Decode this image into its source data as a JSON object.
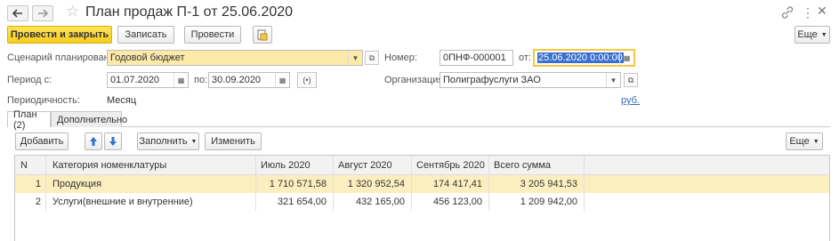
{
  "window": {
    "title": "План продаж П-1 от 25.06.2020"
  },
  "toolbar": {
    "post_close_label": "Провести и закрыть",
    "save_label": "Записать",
    "post_label": "Провести",
    "more_label": "Еще"
  },
  "form": {
    "scenario_label": "Сценарий планирования:",
    "scenario_value": "Годовой бюджет",
    "number_label": "Номер:",
    "number_value": "0ПНФ-000001",
    "date_label": "от:",
    "date_value": "25.06.2020  0:00:00",
    "period_label": "Период с:",
    "period_from": "01.07.2020",
    "period_to_label": "по:",
    "period_to": "30.09.2020",
    "org_label": "Организация:",
    "org_value": "Полиграфуслуги ЗАО",
    "periodicity_label": "Периодичность:",
    "periodicity_value": "Месяц",
    "currency_link": "руб."
  },
  "tabs": [
    {
      "label": "План (2)",
      "active": true
    },
    {
      "label": "Дополнительно",
      "active": false
    }
  ],
  "table_toolbar": {
    "add_label": "Добавить",
    "fill_label": "Заполнить",
    "change_label": "Изменить",
    "more_label": "Еще"
  },
  "table": {
    "columns": [
      "N",
      "Категория номенклатуры",
      "Июль 2020",
      "Август 2020",
      "Сентябрь 2020",
      "Всего сумма"
    ],
    "rows": [
      {
        "n": "1",
        "category": "Продукция",
        "jul": "1 710 571,58",
        "aug": "1 320 952,54",
        "sep": "174 417,41",
        "total": "3 205 941,53",
        "selected": true
      },
      {
        "n": "2",
        "category": "Услуги(внешние и внутренние)",
        "jul": "321 654,00",
        "aug": "432 165,00",
        "sep": "456 123,00",
        "total": "1 209 942,00",
        "selected": false
      }
    ]
  },
  "colors": {
    "primary_button": "#f6cc1c",
    "selected_row": "#fcefbf",
    "active_field": "#fde9a8",
    "link": "#3b6cb5"
  }
}
